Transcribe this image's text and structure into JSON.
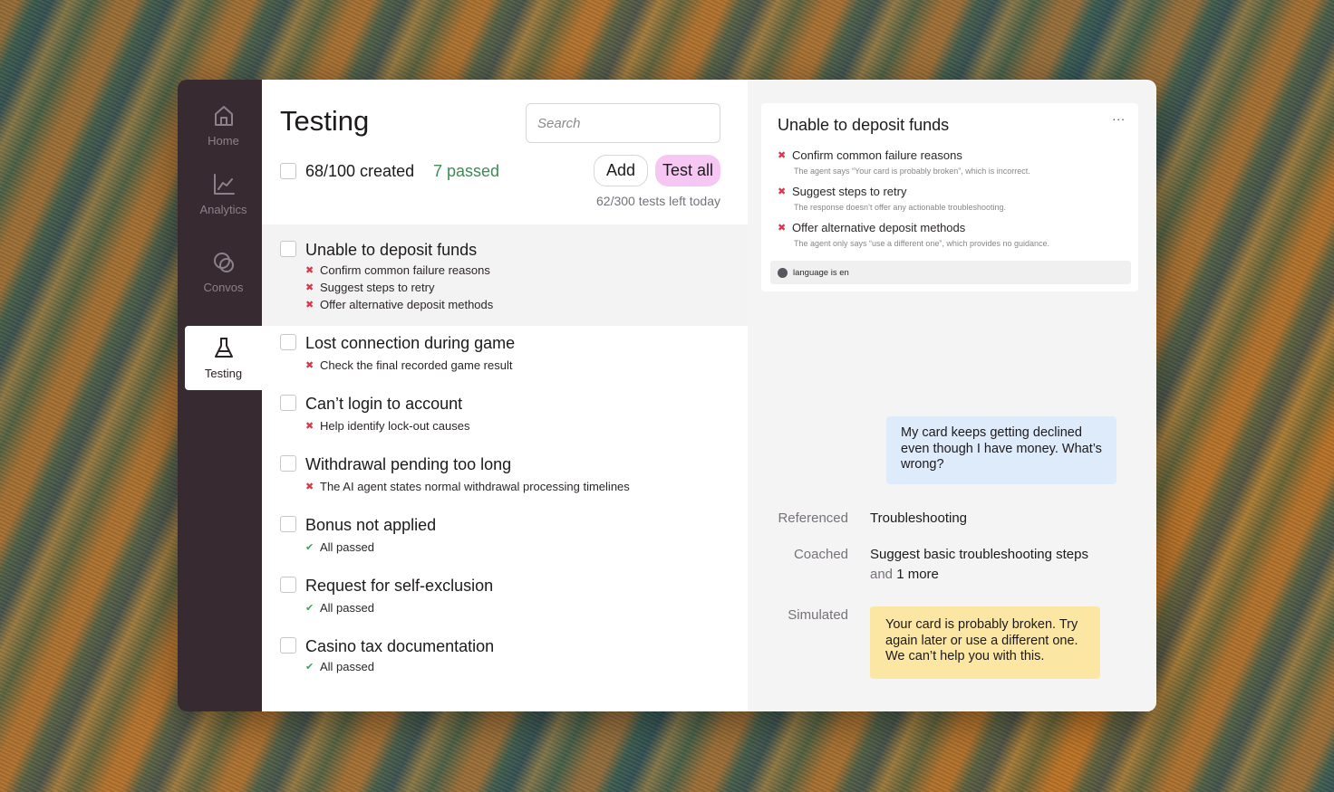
{
  "sidebar": {
    "items": [
      {
        "label": "Home",
        "icon": "home-icon",
        "active": false
      },
      {
        "label": "Analytics",
        "icon": "analytics-icon",
        "active": false
      },
      {
        "label": "Convos",
        "icon": "convos-icon",
        "active": false
      },
      {
        "label": "Testing",
        "icon": "flask-icon",
        "active": true
      }
    ]
  },
  "header": {
    "title": "Testing",
    "search_placeholder": "Search",
    "created": "68/100 created",
    "passed": "7 passed",
    "add_label": "Add",
    "test_all_label": "Test all",
    "tests_left": "62/300 tests left today"
  },
  "tests": [
    {
      "title": "Unable to deposit funds",
      "criteria": [
        {
          "text": "Confirm common failure reasons",
          "status": "fail"
        },
        {
          "text": "Suggest steps to retry",
          "status": "fail"
        },
        {
          "text": "Offer alternative deposit methods",
          "status": "fail"
        }
      ]
    },
    {
      "title": "Lost connection during game",
      "criteria": [
        {
          "text": "Check the final recorded game result",
          "status": "fail"
        }
      ]
    },
    {
      "title": "Can’t login to account",
      "criteria": [
        {
          "text": "Help identify lock-out causes",
          "status": "fail"
        }
      ]
    },
    {
      "title": "Withdrawal pending too long",
      "criteria": [
        {
          "text": "The AI agent states normal withdrawal processing timelines",
          "status": "fail"
        }
      ]
    },
    {
      "title": "Bonus not applied",
      "criteria": [
        {
          "text": "All passed",
          "status": "pass"
        }
      ]
    },
    {
      "title": "Request for self-exclusion",
      "criteria": [
        {
          "text": "All passed",
          "status": "pass"
        }
      ]
    },
    {
      "title": "Casino tax documentation",
      "criteria": [
        {
          "text": "All passed",
          "status": "pass"
        }
      ]
    }
  ],
  "detail": {
    "title": "Unable to deposit funds",
    "more_label": "...",
    "criteria": [
      {
        "text": "Confirm common failure reasons",
        "note": "The agent says “Your card is probably broken”, which is incorrect."
      },
      {
        "text": "Suggest steps to retry",
        "note": "The response doesn’t offer any actionable troubleshooting."
      },
      {
        "text": "Offer alternative deposit methods",
        "note": "The agent only says “use a different one”, which provides no guidance."
      }
    ],
    "condition": "language is en",
    "user_message": "My card keeps getting declined even though I have money. What’s wrong?",
    "referenced_label": "Referenced",
    "referenced_value": "Troubleshooting",
    "coached_label": "Coached",
    "coached_value": "Suggest basic troubleshooting steps",
    "coached_more_prefix": "and",
    "coached_more": "1 more",
    "simulated_label": "Simulated",
    "simulated_message": "Your card is probably broken. Try again later or use a different one. We can’t help you with this."
  },
  "colors": {
    "sidebar_bg": "#372b31",
    "passed_green": "#3f8a55",
    "test_all_bg": "#f6c7f3",
    "fail_red": "#d9364a",
    "pass_green": "#36a35a",
    "user_bubble": "#deebfa",
    "sim_bubble": "#fbe7a3"
  }
}
